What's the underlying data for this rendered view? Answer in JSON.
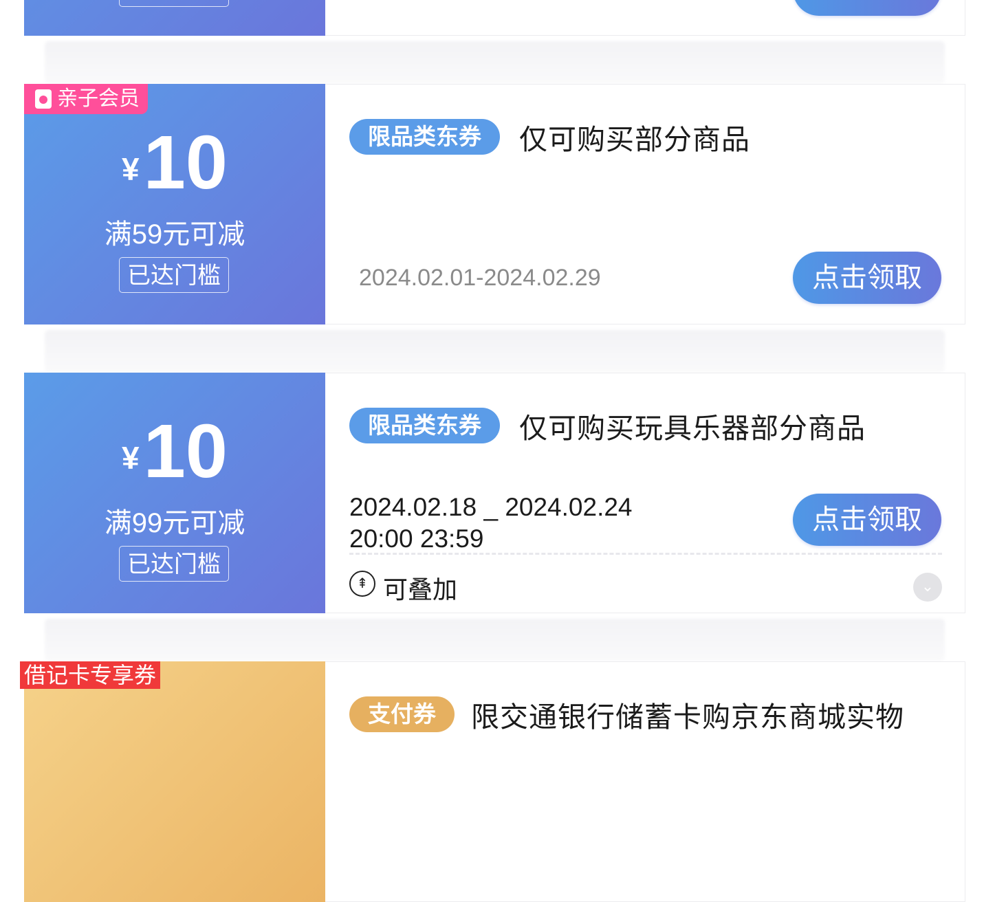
{
  "coupons": [
    {
      "badge": "",
      "reached": "",
      "button": ""
    },
    {
      "badge": "亲子会员",
      "currency": "¥",
      "amount": "10",
      "threshold": "满59元可减",
      "reached": "已达门槛",
      "tag": "限品类东券",
      "title": "仅可购买部分商品",
      "date": "2024.02.01-2024.02.29",
      "button": "点击领取"
    },
    {
      "currency": "¥",
      "amount": "10",
      "threshold": "满99元可减",
      "reached": "已达门槛",
      "tag": "限品类东券",
      "title": "仅可购买玩具乐器部分商品",
      "date": "2024.02.18 _ 2024.02.24\n20:00 23:59",
      "button": "点击领取",
      "stackable": "可叠加"
    },
    {
      "badge": "借记卡专享券",
      "tag": "支付券",
      "title": "限交通银行储蓄卡购京东商城实物"
    }
  ],
  "colors": {
    "blue_start": "#5b9ce8",
    "blue_end": "#6a76db",
    "pink_badge": "#ff4f9a",
    "red_badge": "#f0393a",
    "gold": "#e6b060"
  }
}
